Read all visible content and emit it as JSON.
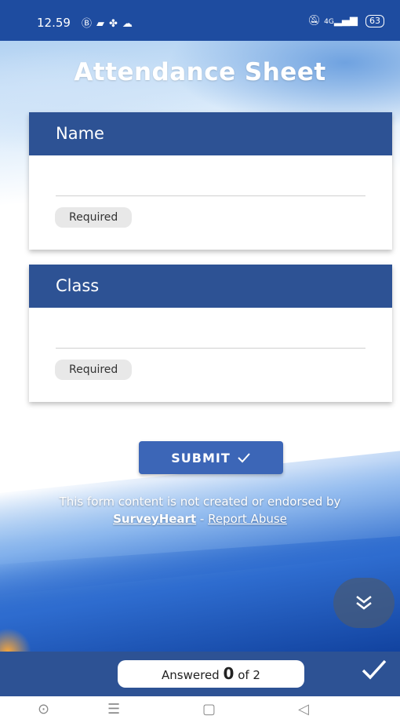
{
  "status_bar": {
    "time": "12.59",
    "left_icons": [
      "b-circle-icon",
      "app-icon",
      "fan-icon",
      "cloud-icon"
    ],
    "right_icons": [
      "mute-icon",
      "signal-icon"
    ],
    "network": "4G",
    "battery": "63"
  },
  "title": "Attendance Sheet",
  "questions": [
    {
      "label": "Name",
      "value": "",
      "badge": "Required"
    },
    {
      "label": "Class",
      "value": "",
      "badge": "Required"
    }
  ],
  "submit": {
    "label": "SUBMIT",
    "icon": "check-icon"
  },
  "disclaimer": {
    "text": "This form content is not created or endorsed by",
    "brand": "SurveyHeart",
    "separator": " - ",
    "report": "Report Abuse"
  },
  "progress": {
    "prefix": "Answered",
    "answered": "0",
    "of": "of 2"
  },
  "colors": {
    "header": "#2d5294",
    "submit": "#3c66b7",
    "status_bar": "#1e4ca0"
  }
}
